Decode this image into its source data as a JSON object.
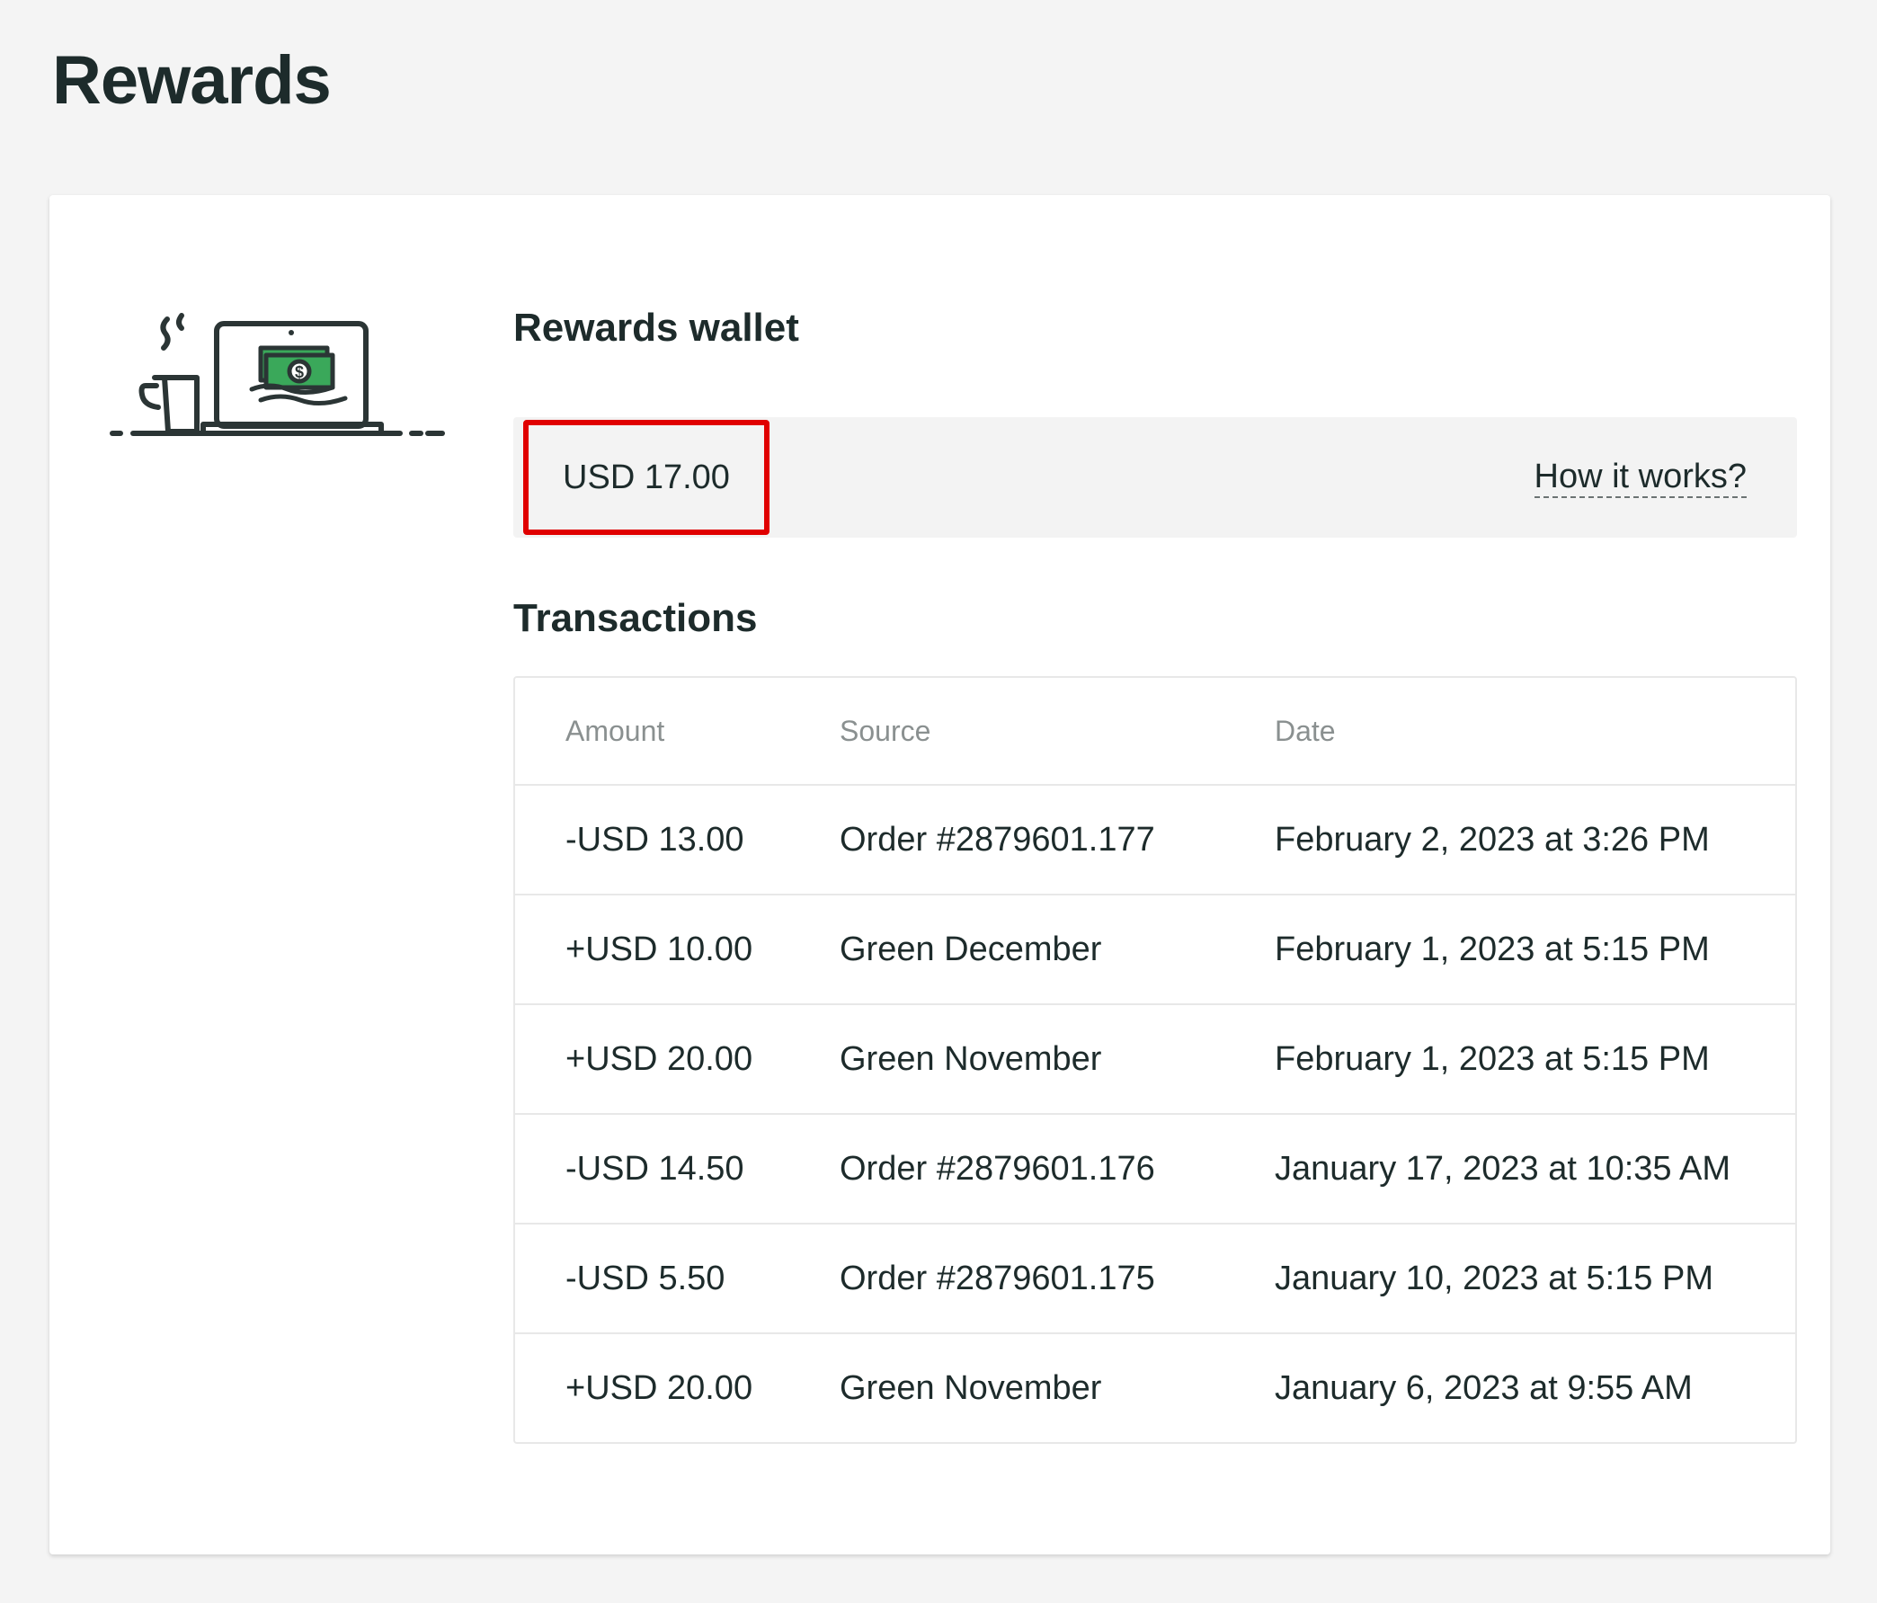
{
  "page": {
    "title": "Rewards"
  },
  "wallet": {
    "title": "Rewards wallet",
    "balance": "USD 17.00",
    "help_link": "How it works?",
    "illustration_icon": "laptop-money-coffee-icon",
    "accent_color": "#3aa85a",
    "highlight_color": "#e00000"
  },
  "transactions": {
    "title": "Transactions",
    "columns": {
      "amount": "Amount",
      "source": "Source",
      "date": "Date"
    },
    "rows": [
      {
        "amount": "-USD 13.00",
        "source": "Order #2879601.177",
        "date": "February 2, 2023 at 3:26 PM"
      },
      {
        "amount": "+USD 10.00",
        "source": "Green December",
        "date": "February 1, 2023 at 5:15 PM"
      },
      {
        "amount": "+USD 20.00",
        "source": "Green November",
        "date": "February 1, 2023 at 5:15 PM"
      },
      {
        "amount": "-USD 14.50",
        "source": "Order #2879601.176",
        "date": "January 17, 2023 at 10:35 AM"
      },
      {
        "amount": "-USD 5.50",
        "source": "Order #2879601.175",
        "date": "January 10, 2023 at 5:15 PM"
      },
      {
        "amount": "+USD 20.00",
        "source": "Green November",
        "date": "January 6, 2023 at 9:55 AM"
      }
    ]
  }
}
